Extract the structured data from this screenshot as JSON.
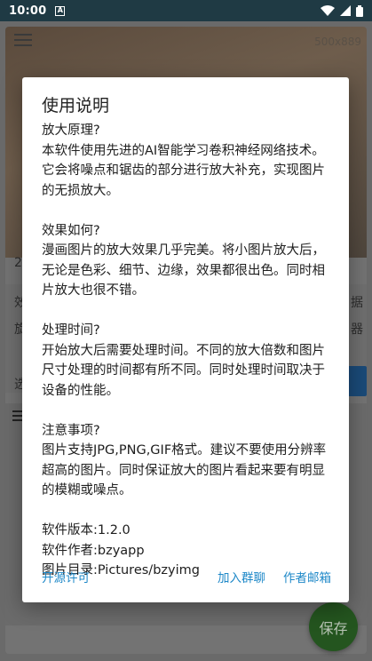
{
  "status_bar": {
    "time": "10:00",
    "notification_icon": "a-letter-icon",
    "icons": [
      "wifi-icon",
      "signal-icon",
      "battery-icon"
    ]
  },
  "background": {
    "image_size": "500x889",
    "fragments": [
      "2",
      "效",
      "旋",
      "选"
    ],
    "fragments_right": [
      "据",
      "器"
    ],
    "save_button": "保存"
  },
  "dialog": {
    "title": "使用说明",
    "sections": [
      {
        "heading": "放大原理?",
        "text": "本软件使用先进的AI智能学习卷积神经网络技术。它会将噪点和锯齿的部分进行放大补充，实现图片的无损放大。"
      },
      {
        "heading": "效果如何?",
        "text": "漫画图片的放大效果几乎完美。将小图片放大后，无论是色彩、细节、边缘，效果都很出色。同时相片放大也很不错。"
      },
      {
        "heading": "处理时间?",
        "text": "开始放大后需要处理时间。不同的放大倍数和图片尺寸处理的时间都有所不同。同时处理时间取决于设备的性能。"
      },
      {
        "heading": "注意事项?",
        "text": "图片支持JPG,PNG,GIF格式。建议不要使用分辨率超高的图片。同时保证放大的图片看起来要有明显的模糊或噪点。"
      }
    ],
    "meta": {
      "version": "软件版本:1.2.0",
      "author": "软件作者:bzyapp",
      "directory": "图片目录:Pictures/bzyimg"
    },
    "actions": {
      "license": "开源许可",
      "join_group": "加入群聊",
      "email": "作者邮箱"
    }
  },
  "colors": {
    "link": "#1e88c8",
    "status_bar": "#1f3a44",
    "fab": "#24551f"
  }
}
